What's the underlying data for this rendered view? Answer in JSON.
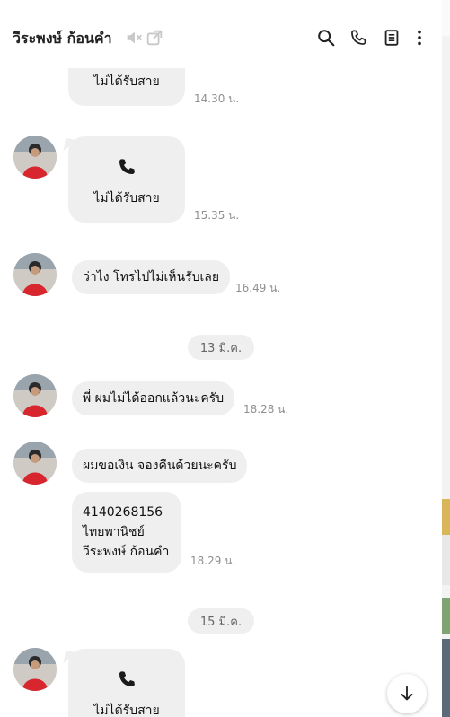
{
  "header": {
    "contact_name": "วีระพงษ์ ก้อนคำ",
    "icons": [
      "mute-icon",
      "external-link-icon",
      "search-icon",
      "phone-icon",
      "notes-icon",
      "more-icon"
    ]
  },
  "messages": {
    "m1_label": "ไม่ได้รับสาย",
    "m1_time": "14.30 น.",
    "m2_label": "ไม่ได้รับสาย",
    "m2_time": "15.35 น.",
    "m3_text": "ว่าไง โทรไปไม่เห็นรับเลย",
    "m3_time": "16.49 น.",
    "date1": "13 มี.ค.",
    "m4_text": "พี่ ผมไม่ได้ออกแล้วนะครับ",
    "m4_time": "18.28 น.",
    "m5_text": "ผมขอเงิน จองคืนด้วยนะครับ",
    "m6_line1": "4140268156",
    "m6_line2": "ไทยพานิชย์",
    "m6_line3": "วีระพงษ์ ก้อนคำ",
    "m6_time": "18.29 น.",
    "date2": "15 มี.ค.",
    "m7_label": "ไม่ได้รับสาย"
  },
  "colors": {
    "bubble": "#efefef",
    "time": "#8f8f8f",
    "avatar_shirt": "#d8262f"
  }
}
